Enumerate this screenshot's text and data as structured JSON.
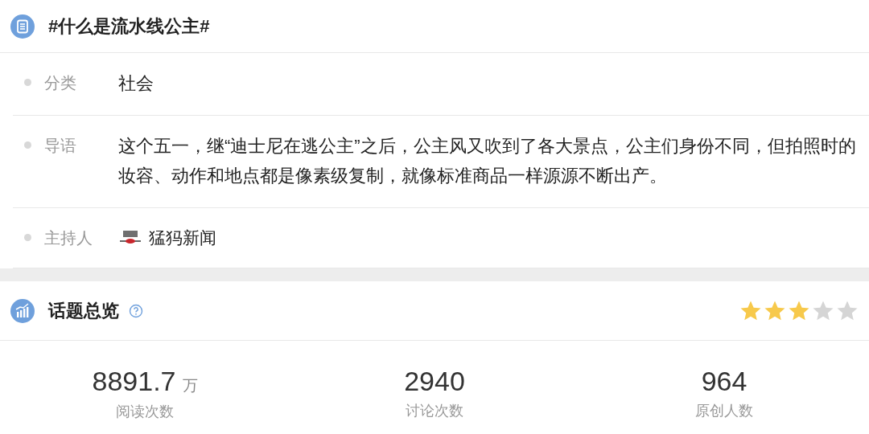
{
  "topic": {
    "title": "#什么是流水线公主#"
  },
  "info_rows": [
    {
      "kind": "text",
      "label": "分类",
      "value": "社会"
    },
    {
      "kind": "text",
      "label": "导语",
      "value": "这个五一，继“迪士尼在逃公主”之后，公主风又吹到了各大景点，公主们身份不同，但拍照时的妆容、动作和地点都是像素级复制，就像标准商品一样源源不断出产。"
    },
    {
      "kind": "host",
      "label": "主持人",
      "value": "猛犸新闻"
    }
  ],
  "overview": {
    "title": "话题总览",
    "stars": 3,
    "stats": [
      {
        "number": "8891.7",
        "unit": "万",
        "label": "阅读次数"
      },
      {
        "number": "2940",
        "label": "讨论次数"
      },
      {
        "number": "964",
        "label": "原创人数"
      }
    ]
  }
}
